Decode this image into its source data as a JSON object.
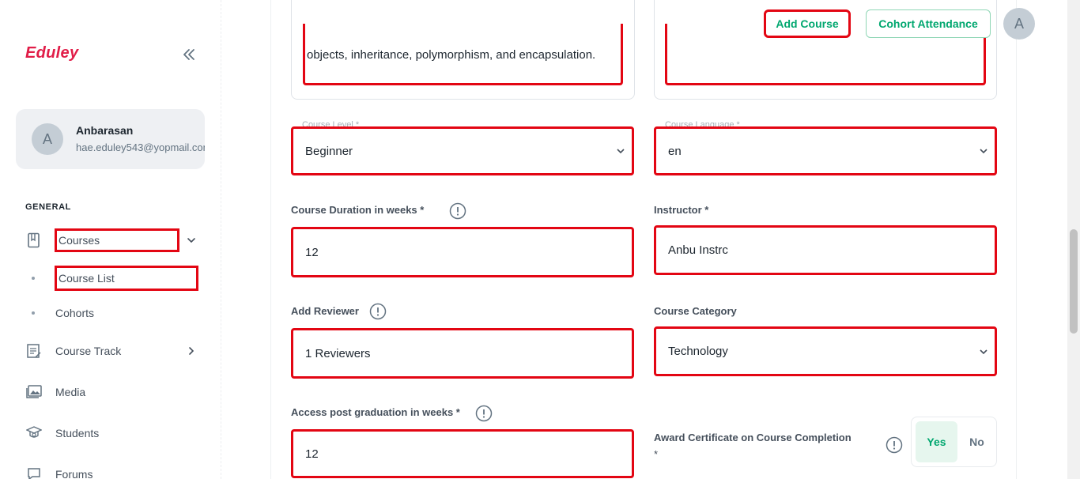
{
  "sidebar": {
    "logo": "Eduley",
    "user": {
      "initial": "A",
      "name": "Anbarasan",
      "email": "hae.eduley543@yopmail.com"
    },
    "section_title": "GENERAL",
    "items": [
      {
        "label": "Courses",
        "icon": "book-icon"
      },
      {
        "label": "Course List"
      },
      {
        "label": "Cohorts"
      },
      {
        "label": "Course Track",
        "icon": "course-track-icon"
      },
      {
        "label": "Media",
        "icon": "media-icon"
      },
      {
        "label": "Students",
        "icon": "graduation-cap-icon"
      },
      {
        "label": "Forums",
        "icon": "forum-icon"
      }
    ]
  },
  "header": {
    "add_course": "Add Course",
    "cohort_attendance": "Cohort Attendance",
    "avatar_initial": "A"
  },
  "form": {
    "description_text": "objects, inheritance, polymorphism, and encapsulation.",
    "course_level": {
      "label": "Course Level *",
      "value": "Beginner"
    },
    "course_language": {
      "label": "Course Language *",
      "value": "en"
    },
    "duration": {
      "label": "Course Duration in weeks *",
      "value": "12"
    },
    "instructor": {
      "label": "Instructor *",
      "value": "Anbu Instrc"
    },
    "reviewer": {
      "label": "Add Reviewer",
      "value": "1 Reviewers"
    },
    "category": {
      "label": "Course Category",
      "value": "Technology"
    },
    "access_post_graduation": {
      "label": "Access post graduation in weeks *",
      "value": "12"
    },
    "award_certificate": {
      "label": "Award Certificate on Course Completion",
      "required_mark": "*",
      "yes": "Yes",
      "no": "No"
    }
  },
  "colors": {
    "accent": "#00a76f",
    "highlight": "#e30613",
    "logo": "#e11d48"
  }
}
